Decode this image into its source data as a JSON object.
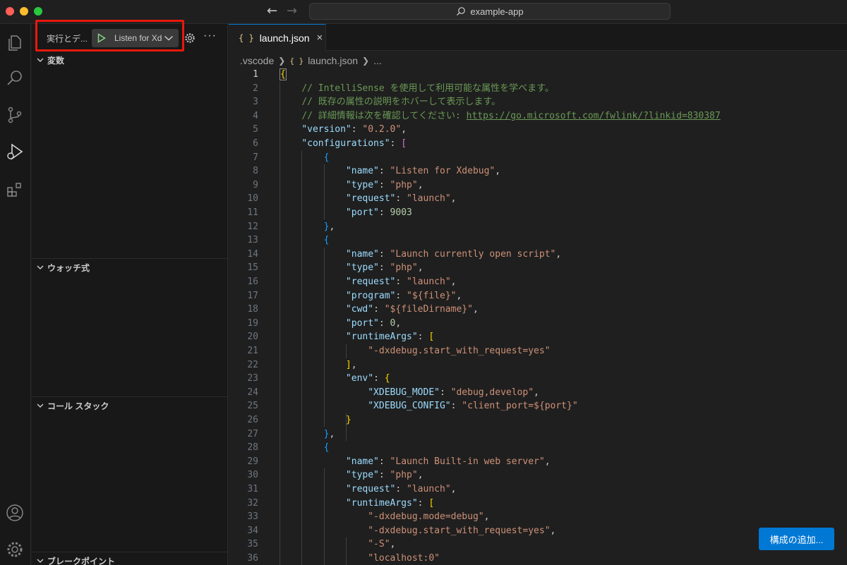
{
  "titlebar": {
    "search_text": "example-app",
    "back_icon": "arrow-left-icon",
    "forward_icon": "arrow-right-icon"
  },
  "activity_bar": {
    "items": [
      "explorer-icon",
      "search-icon",
      "source-control-icon",
      "run-debug-icon",
      "extensions-icon"
    ],
    "bottom_items": [
      "account-icon",
      "manage-gear-icon"
    ]
  },
  "sidebar": {
    "title": "実行とデ...",
    "launch_config": "Listen for Xdebug",
    "sections": {
      "variables": "変数",
      "watch": "ウォッチ式",
      "call_stack": "コール スタック",
      "breakpoints": "ブレークポイント"
    },
    "more_label": "···"
  },
  "editor": {
    "tab_label": "launch.json",
    "tab_braces": "{ }",
    "tab_close": "×",
    "breadcrumb": {
      "folder": ".vscode",
      "file": "launch.json",
      "more": "..."
    },
    "active_line": 1,
    "add_config_button": "構成の追加..."
  },
  "code_lines": [
    {
      "n": "1"
    },
    {
      "n": "2"
    },
    {
      "n": "3"
    },
    {
      "n": "4"
    },
    {
      "n": "5"
    },
    {
      "n": "6"
    },
    {
      "n": "7"
    },
    {
      "n": "8"
    },
    {
      "n": "9"
    },
    {
      "n": "10"
    },
    {
      "n": "11"
    },
    {
      "n": "12"
    },
    {
      "n": "13"
    },
    {
      "n": "14"
    },
    {
      "n": "15"
    },
    {
      "n": "16"
    },
    {
      "n": "17"
    },
    {
      "n": "18"
    },
    {
      "n": "19"
    },
    {
      "n": "20"
    },
    {
      "n": "21"
    },
    {
      "n": "22"
    },
    {
      "n": "23"
    },
    {
      "n": "24"
    },
    {
      "n": "25"
    },
    {
      "n": "26"
    },
    {
      "n": "27"
    },
    {
      "n": "28"
    },
    {
      "n": "29"
    },
    {
      "n": "30"
    },
    {
      "n": "31"
    },
    {
      "n": "32"
    },
    {
      "n": "33"
    },
    {
      "n": "34"
    },
    {
      "n": "35"
    },
    {
      "n": "36"
    }
  ],
  "code": {
    "l1_open": "{",
    "l2_comment": "// IntelliSense を使用して利用可能な属性を学べます。",
    "l3_comment": "// 既存の属性の説明をホバーして表示します。",
    "l4_comment": "// 詳細情報は次を確認してください: ",
    "l4_url": "https://go.microsoft.com/fwlink/?linkid=830387",
    "version_key": "\"version\"",
    "version_val": "\"0.2.0\"",
    "configurations_key": "\"configurations\"",
    "name_key": "\"name\"",
    "type_key": "\"type\"",
    "request_key": "\"request\"",
    "port_key": "\"port\"",
    "program_key": "\"program\"",
    "cwd_key": "\"cwd\"",
    "runtimeArgs_key": "\"runtimeArgs\"",
    "env_key": "\"env\"",
    "xdebug_mode_key": "\"XDEBUG_MODE\"",
    "xdebug_config_key": "\"XDEBUG_CONFIG\"",
    "c1_name": "\"Listen for Xdebug\"",
    "php": "\"php\"",
    "launch": "\"launch\"",
    "c1_port": "9003",
    "c2_name": "\"Launch currently open script\"",
    "c2_program": "\"${file}\"",
    "c2_cwd": "\"${fileDirname}\"",
    "c2_port": "0",
    "c2_arg1": "\"-dxdebug.start_with_request=yes\"",
    "xdebug_mode_val": "\"debug,develop\"",
    "xdebug_config_val": "\"client_port=${port}\"",
    "c3_name": "\"Launch Built-in web server\"",
    "c3_arg1": "\"-dxdebug.mode=debug\"",
    "c3_arg2": "\"-dxdebug.start_with_request=yes\"",
    "c3_arg3": "\"-S\"",
    "c3_arg4": "\"localhost:0\""
  },
  "colors": {
    "accent": "#0078d4",
    "highlight_box": "#e8180c",
    "run_play": "#89d185"
  }
}
